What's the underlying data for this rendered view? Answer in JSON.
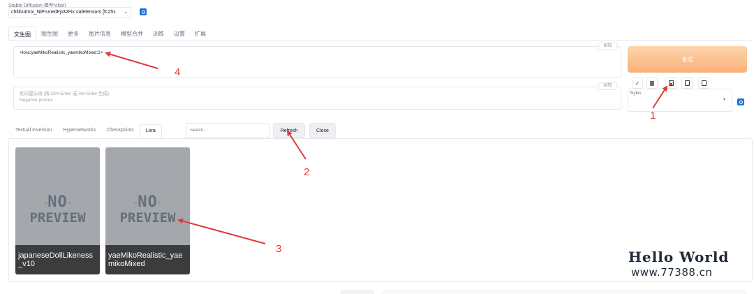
{
  "checkpoint": {
    "label": "Stable Diffusion 模型(ckpt)",
    "selected": "chilloutmix_NiPrunedFp32Fix.safetensors [fc251"
  },
  "tabs": [
    {
      "label": "文生图",
      "active": true
    },
    {
      "label": "图生图"
    },
    {
      "label": "更多"
    },
    {
      "label": "图片信息"
    },
    {
      "label": "模型合并"
    },
    {
      "label": "训练"
    },
    {
      "label": "设置"
    },
    {
      "label": "扩展"
    }
  ],
  "prompt": {
    "value": "<lora:yaeMikoRealistic_yaemikoMixed:1>",
    "counter": "0/75"
  },
  "negative_prompt": {
    "placeholder_line1": "反向提示词 (按 Ctrl+Enter 或 Alt+Enter 生成)",
    "placeholder_line2": "Negative prompt",
    "counter": "0/75"
  },
  "generate_button": "生成",
  "tools": [
    "check-icon",
    "trash-icon",
    "extra-networks-icon",
    "paste-icon",
    "save-style-icon"
  ],
  "styles": {
    "label": "Styles"
  },
  "extra_networks": {
    "tabs": [
      {
        "label": "Textual Inversion"
      },
      {
        "label": "Hypernetworks"
      },
      {
        "label": "Checkpoints"
      },
      {
        "label": "Lora",
        "active": true
      }
    ],
    "search_placeholder": "Search...",
    "refresh_label": "Refresh",
    "close_label": "Close",
    "cards": [
      {
        "preview_line1": "NO",
        "preview_line2": "PREVIEW",
        "name": "japaneseDollLikeness_v10"
      },
      {
        "preview_line1": "NO",
        "preview_line2": "PREVIEW",
        "name": "yaeMikoRealistic_yaemikoMixed"
      }
    ]
  },
  "annotations": {
    "n1": "1",
    "n2": "2",
    "n3": "3",
    "n4": "4",
    "color": "#e03a3a"
  },
  "watermark": {
    "title": "Hello World",
    "site": "www.77388.cn"
  },
  "colors": {
    "accent": "#1d73d6",
    "generate_gradient_top": "#fdd4ac",
    "generate_gradient_bottom": "#fbb07a",
    "card_bg": "#a4a8ad"
  }
}
